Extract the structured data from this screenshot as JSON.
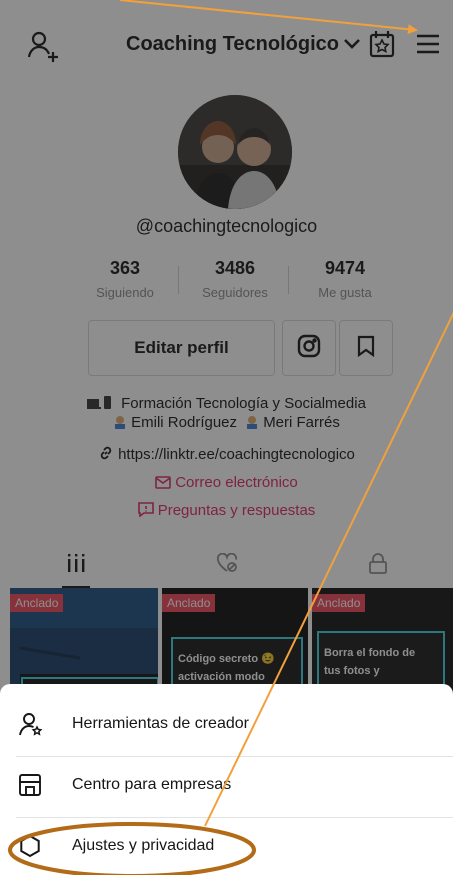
{
  "header": {
    "account_name": "Coaching Tecnológico",
    "add_user_icon": "add-user-icon",
    "chevron_icon": "chevron-down-icon",
    "calendar_icon": "calendar-star-icon",
    "menu_icon": "hamburger-menu-icon"
  },
  "profile": {
    "handle": "@coachingtecnologico",
    "stats": [
      {
        "value": "363",
        "label": "Siguiendo"
      },
      {
        "value": "3486",
        "label": "Seguidores"
      },
      {
        "value": "9474",
        "label": "Me gusta"
      }
    ],
    "edit_button": "Editar perfil",
    "instagram_icon": "instagram-icon",
    "bookmark_icon": "bookmark-icon",
    "bio_line1": "Formación Tecnología y Socialmedia",
    "bio_line2": "Emili Rodríguez",
    "bio_line2b": "Meri Farrés",
    "link": "https://linktr.ee/coachingtecnologico",
    "email_link": "Correo electrónico",
    "qa_link": "Preguntas y respuestas",
    "accent": "#e0295f"
  },
  "tabs": [
    "videos-grid-icon",
    "liked-videos-icon",
    "private-videos-icon"
  ],
  "videos": [
    {
      "pin": "Anclado",
      "text": ""
    },
    {
      "pin": "Anclado",
      "text": "Código secreto 😉 activación modo"
    },
    {
      "pin": "Anclado",
      "text": "Borra el fondo de tus fotos y"
    }
  ],
  "menu": {
    "items": [
      {
        "label": "Herramientas de creador",
        "icon": "creator-tools-icon"
      },
      {
        "label": "Centro para empresas",
        "icon": "store-icon"
      },
      {
        "label": "Ajustes y privacidad",
        "icon": "settings-gear-icon"
      }
    ]
  },
  "annotation_color": "#f2a03c",
  "highlight_color": "#b36b17"
}
